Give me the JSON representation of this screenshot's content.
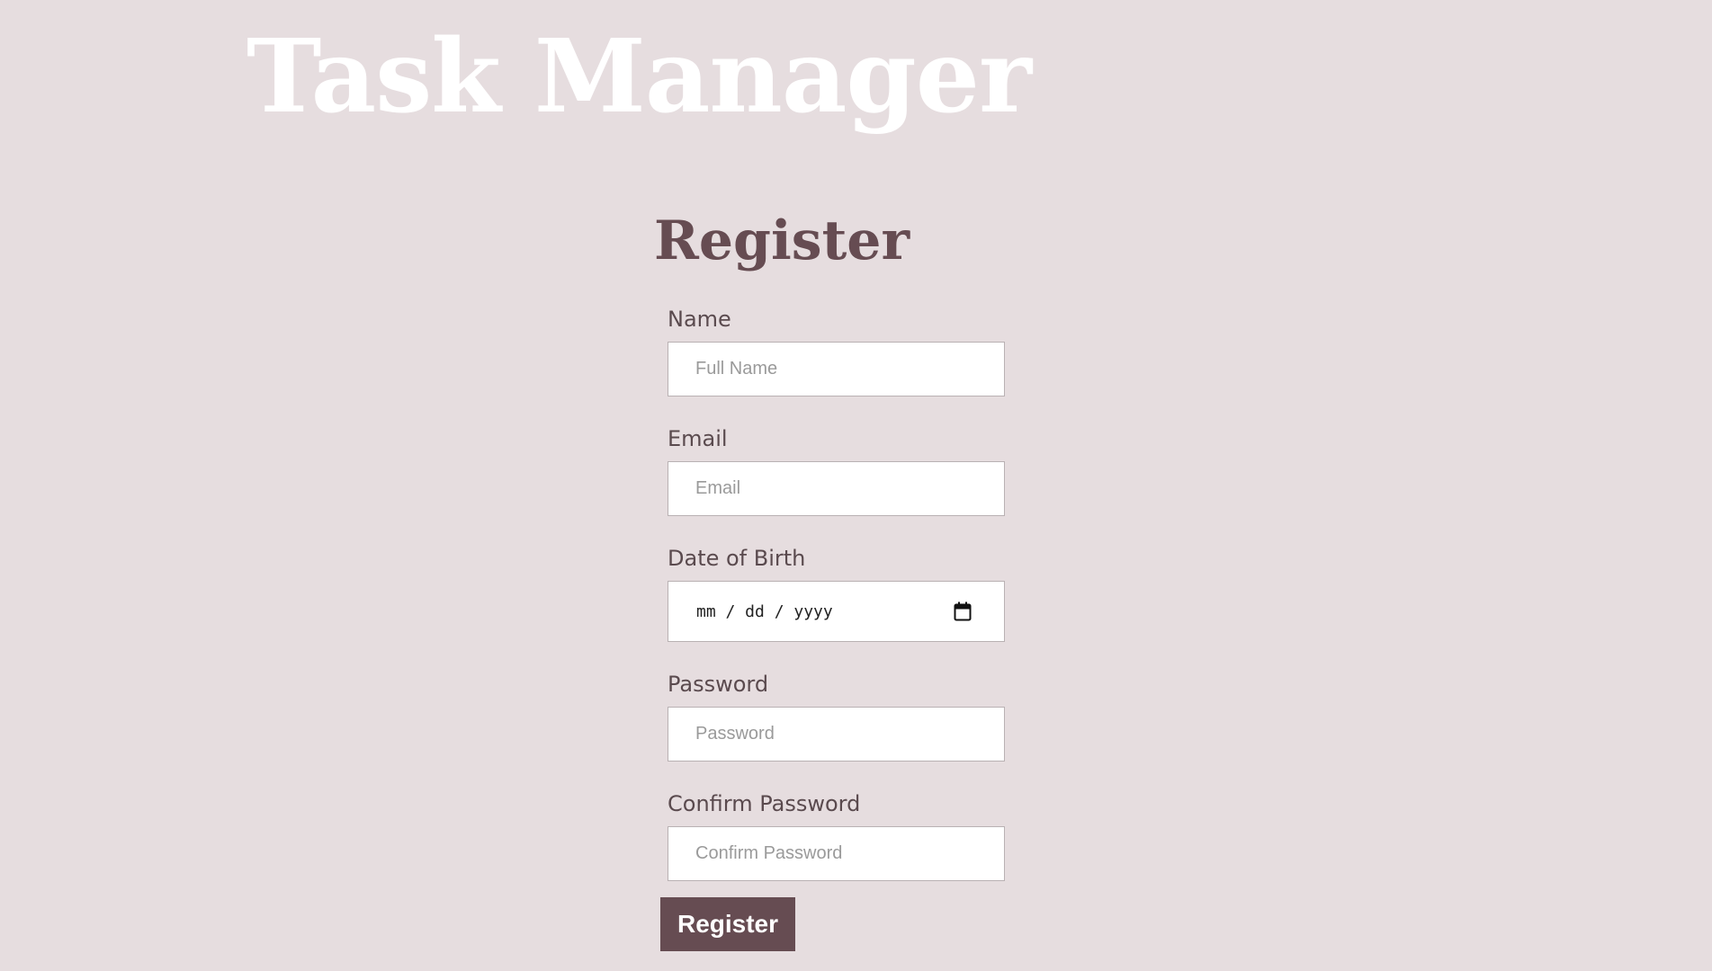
{
  "header": {
    "app_title": "Task Manager"
  },
  "form": {
    "title": "Register",
    "fields": {
      "name": {
        "label": "Name",
        "placeholder": "Full Name",
        "value": ""
      },
      "email": {
        "label": "Email",
        "placeholder": "Email",
        "value": ""
      },
      "dob": {
        "label": "Date of Birth",
        "placeholder": "mm / dd / yyyy",
        "icon": "calendar-icon"
      },
      "password": {
        "label": "Password",
        "placeholder": "Password",
        "value": ""
      },
      "confirm_password": {
        "label": "Confirm Password",
        "placeholder": "Confirm Password",
        "value": ""
      }
    },
    "submit_label": "Register"
  },
  "colors": {
    "background": "#e6dddf",
    "accent": "#664c52",
    "title_text": "#ffffff",
    "label_text": "#5a4a4e"
  }
}
